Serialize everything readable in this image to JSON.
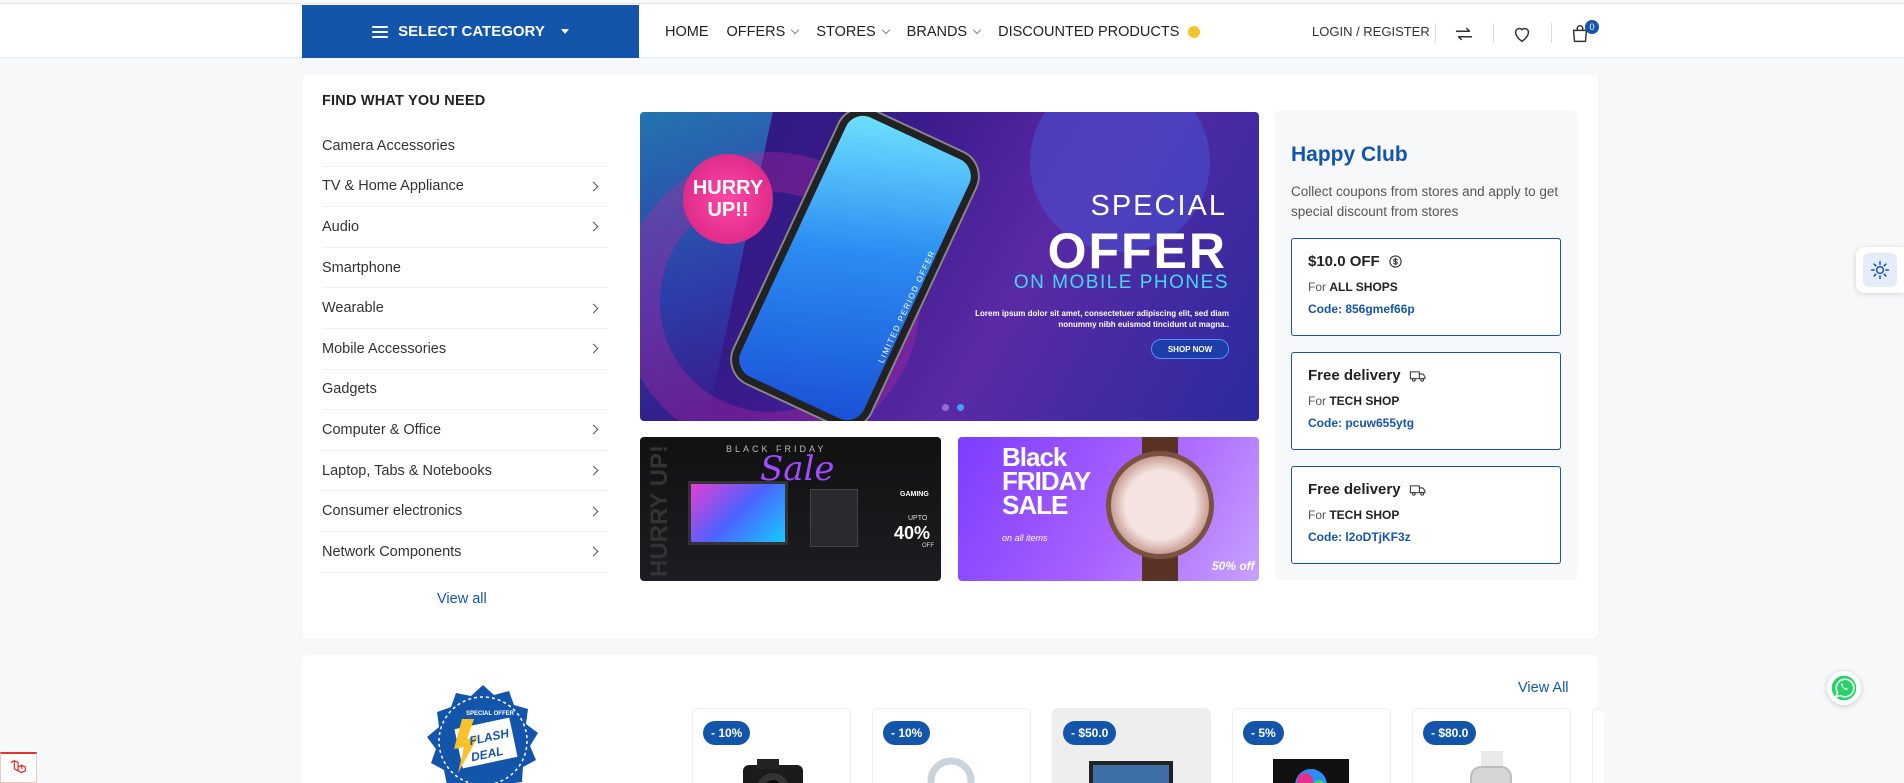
{
  "header": {
    "category_button": "SELECT CATEGORY",
    "nav": [
      {
        "label": "HOME",
        "has_dropdown": false
      },
      {
        "label": "OFFERS",
        "has_dropdown": true
      },
      {
        "label": "STORES",
        "has_dropdown": true
      },
      {
        "label": "BRANDS",
        "has_dropdown": true
      },
      {
        "label": "DISCOUNTED PRODUCTS",
        "has_dropdown": false
      }
    ],
    "login": "LOGIN / REGISTER",
    "cart_count": "0",
    "icons": [
      "compare-icon",
      "heart-icon",
      "cart-icon"
    ],
    "accent": "#1455ac"
  },
  "categories": {
    "title": "FIND WHAT YOU NEED",
    "items": [
      {
        "label": "Camera Accessories",
        "has_sub": false
      },
      {
        "label": "TV & Home Appliance",
        "has_sub": true
      },
      {
        "label": "Audio",
        "has_sub": true
      },
      {
        "label": "Smartphone",
        "has_sub": false
      },
      {
        "label": "Wearable",
        "has_sub": true
      },
      {
        "label": "Mobile Accessories",
        "has_sub": true
      },
      {
        "label": "Gadgets",
        "has_sub": false
      },
      {
        "label": "Computer & Office",
        "has_sub": true
      },
      {
        "label": "Laptop, Tabs & Notebooks",
        "has_sub": true
      },
      {
        "label": "Consumer electronics",
        "has_sub": true
      },
      {
        "label": "Network Components",
        "has_sub": true
      }
    ],
    "view_all": "View all"
  },
  "hero": {
    "badge_line1": "HURRY",
    "badge_line2": "UP!!",
    "phone_label": "LIMITED PERIOD OFFER",
    "special": "SPECIAL",
    "offer": "OFFER",
    "on_mobile": "ON MOBILE PHONES",
    "lorem": "Lorem ipsum dolor sit amet, consectetuer adipiscing elit, sed diam nonummy nibh euismod tincidunt ut magna..",
    "shop_now": "SHOP NOW"
  },
  "banner1": {
    "black_friday": "BLACK FRIDAY",
    "sale": "Sale",
    "hurry": "HURRY UP!",
    "gaming": "GAMING",
    "upto": "UPTO",
    "pct": "40%",
    "off": "OFF"
  },
  "banner2": {
    "line1": "Black",
    "line2": "FRIDAY",
    "line3": "SALE",
    "all_items": "on all items",
    "pct": "50% off"
  },
  "club": {
    "title": "Happy Club",
    "desc": "Collect coupons from stores and apply to get special discount from stores",
    "coupons": [
      {
        "title": "$10.0 OFF",
        "icon": "dollar-icon",
        "for_prefix": "For",
        "for_shop": "ALL SHOPS",
        "code": "Code: 856gmef66p"
      },
      {
        "title": "Free delivery",
        "icon": "truck-icon",
        "for_prefix": "For",
        "for_shop": "TECH SHOP",
        "code": "Code: pcuw655ytg"
      },
      {
        "title": "Free delivery",
        "icon": "truck-icon",
        "for_prefix": "For",
        "for_shop": "TECH SHOP",
        "code": "Code: l2oDTjKF3z"
      }
    ]
  },
  "flash": {
    "badge_line1": "SPECIAL OFFER",
    "badge_line2": "FLASH",
    "badge_line3": "DEAL",
    "view_all": "View All",
    "products": [
      {
        "discount": "- 10%"
      },
      {
        "discount": "- 10%"
      },
      {
        "discount": "- $50.0"
      },
      {
        "discount": "- 5%"
      },
      {
        "discount": "- $80.0"
      }
    ]
  }
}
